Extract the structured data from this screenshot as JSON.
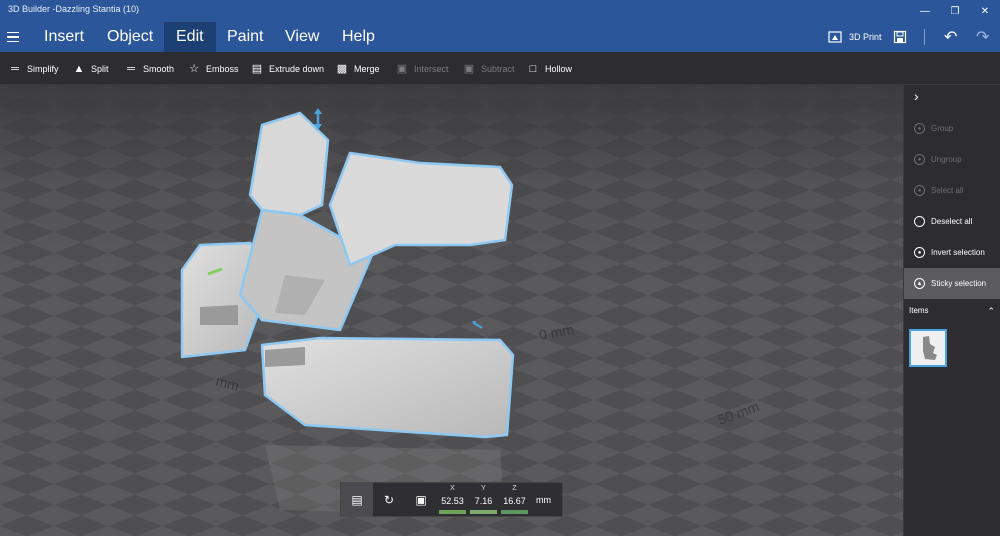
{
  "window": {
    "title": "3D Builder -Dazzling Stantia (10)",
    "controls": [
      "minimize",
      "maximize",
      "close"
    ]
  },
  "menu": {
    "items": [
      "Insert",
      "Object",
      "Edit",
      "Paint",
      "View",
      "Help"
    ],
    "active": "Edit",
    "print_label": "3D Print"
  },
  "toolbar": {
    "simplify": "Simplify",
    "split": "Split",
    "smooth": "Smooth",
    "emboss": "Emboss",
    "extrude_down": "Extrude down",
    "merge": "Merge",
    "intersect": "Intersect",
    "subtract": "Subtract",
    "hollow": "Hollow"
  },
  "right_panel": {
    "group": "Group",
    "ungroup": "Ungroup",
    "select_all": "Select all",
    "deselect_all": "Deselect all",
    "invert_selection": "Invert selection",
    "sticky_selection": "Sticky selection",
    "items_header": "Items"
  },
  "viewport": {
    "ruler_label_right": "0 mm",
    "ruler_label_bottom": "50 mm",
    "ruler_label_left": "mm"
  },
  "transform": {
    "x_label": "X",
    "y_label": "Y",
    "z_label": "Z",
    "x": "52.53",
    "y": "7.16",
    "z": "16.67",
    "unit": "mm"
  },
  "colors": {
    "title_bar": "#2b579a",
    "selection_outline": "#8ec7f0",
    "x_axis": "#7fbf5f",
    "y_axis": "#8fbf7f",
    "z_axis": "#6fa96f"
  }
}
